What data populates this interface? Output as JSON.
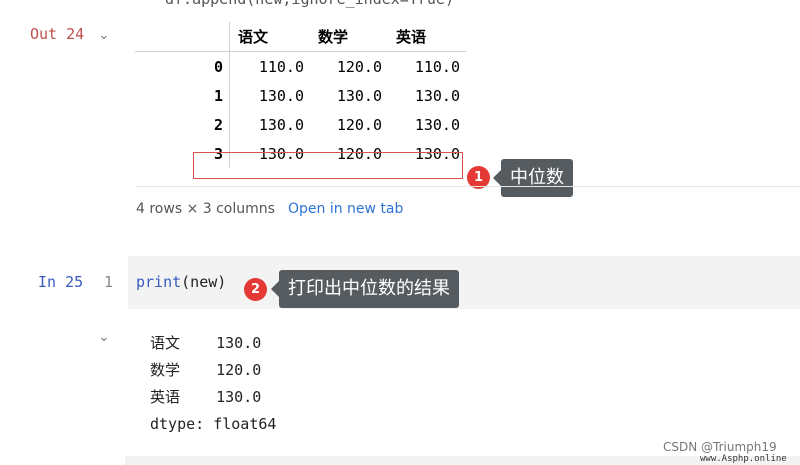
{
  "top_code": "df.append(new,ignore_index=True)",
  "out_cell": {
    "label": "Out 24"
  },
  "dataframe": {
    "columns": [
      "语文",
      "数学",
      "英语"
    ],
    "rows": [
      {
        "index": "0",
        "values": [
          "110.0",
          "120.0",
          "110.0"
        ]
      },
      {
        "index": "1",
        "values": [
          "130.0",
          "130.0",
          "130.0"
        ]
      },
      {
        "index": "2",
        "values": [
          "130.0",
          "120.0",
          "130.0"
        ]
      },
      {
        "index": "3",
        "values": [
          "130.0",
          "120.0",
          "130.0"
        ]
      }
    ],
    "summary": "4 rows × 3 columns",
    "open_link": "Open in new tab"
  },
  "annotations": [
    {
      "number": "1",
      "text": "中位数"
    },
    {
      "number": "2",
      "text": "打印出中位数的结果"
    }
  ],
  "in_cell": {
    "label": "In 25",
    "line_number": "1",
    "code_fn": "print",
    "code_rest": "(new)"
  },
  "output": {
    "lines": [
      "语文    130.0",
      "数学    120.0",
      "英语    130.0",
      "dtype: float64"
    ]
  },
  "watermark": {
    "csdn": "CSDN @Triumph19",
    "site": "www.Asphp.online"
  },
  "colors": {
    "out_label": "#c0504d",
    "in_label": "#3a5bbf",
    "highlight": "#d9534f",
    "badge": "#e53935",
    "tooltip": "#555b5e",
    "link": "#2e74d6"
  }
}
